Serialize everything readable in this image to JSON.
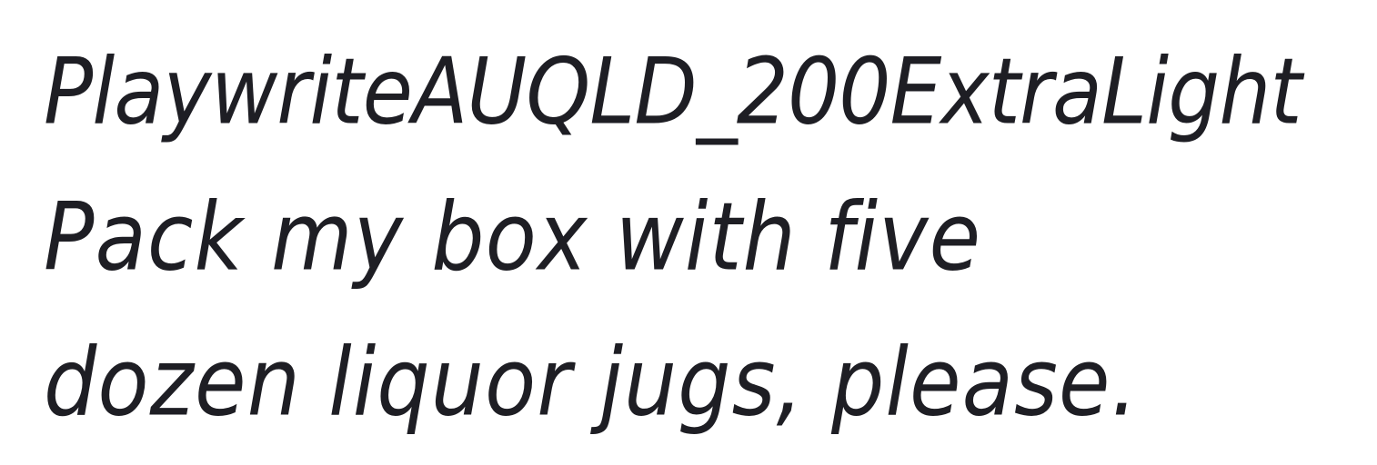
{
  "specimen": {
    "font_name": "PlaywriteAUQLD_200ExtraLight",
    "sample_line_1": "Pack my box with five",
    "sample_line_2": "dozen liquor jugs, please.",
    "text_color": "#1e1e24",
    "background_color": "#ffffff"
  }
}
